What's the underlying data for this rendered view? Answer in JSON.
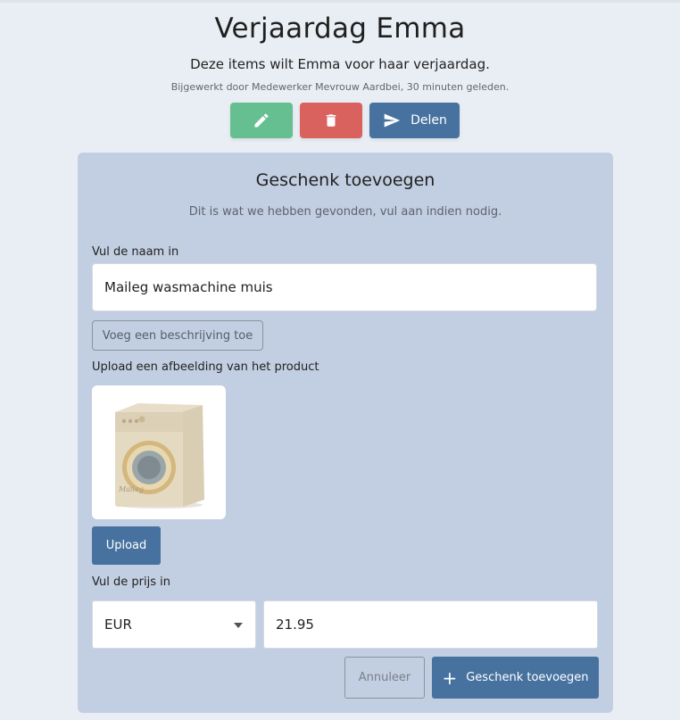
{
  "header": {
    "title": "Verjaardag Emma",
    "subtitle": "Deze items wilt Emma voor haar verjaardag.",
    "updated": "Bijgewerkt door Medewerker Mevrouw Aardbei, 30 minuten geleden."
  },
  "actions": {
    "edit_icon": "pencil-icon",
    "delete_icon": "trash-icon",
    "share_icon": "send-icon",
    "share_label": "Delen",
    "colors": {
      "edit": "#66bf91",
      "delete": "#d9625f",
      "share": "#47729f"
    }
  },
  "form": {
    "title": "Geschenk toevoegen",
    "hint": "Dit is wat we hebben gevonden, vul aan indien nodig.",
    "name_label": "Vul de naam in",
    "name_value": "Maileg wasmachine muis",
    "description_button": "Voeg een beschrijving toe",
    "image_label": "Upload een afbeelding van het product",
    "image_brand": "Maileg",
    "upload_button": "Upload",
    "price_label": "Vul de prijs in",
    "currency": "EUR",
    "price": "21.95",
    "cancel_button": "Annuleer",
    "submit_button": "Geschenk toevoegen",
    "submit_icon": "plus-icon"
  }
}
